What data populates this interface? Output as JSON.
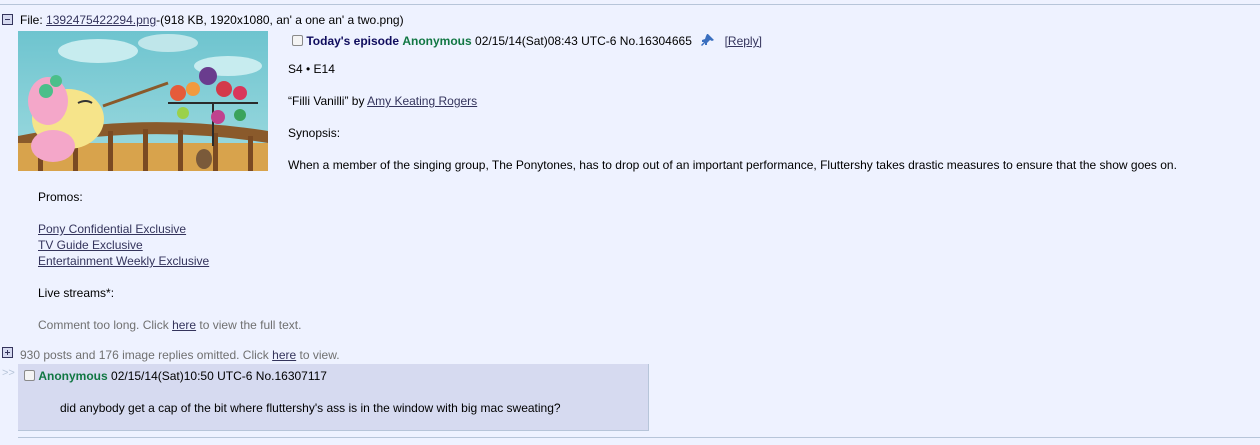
{
  "op": {
    "file": {
      "label": "File: ",
      "filename": "1392475422294.png",
      "meta": "-(918 KB, 1920x1080, an' a one an' a two.png)"
    },
    "subject": "Today's episode",
    "name": "Anonymous",
    "datetime": "02/15/14(Sat)08:43 UTC-6",
    "post_no": "No.16304665",
    "reply_link": "[Reply]",
    "episode": "S4 • E14",
    "title_quote": "“Filli Vanilli” by ",
    "writer": "Amy Keating Rogers",
    "synopsis_label": "Synopsis:",
    "synopsis": "When a member of the singing group, The Ponytones, has to drop out of an important performance, Fluttershy takes drastic measures to ensure that the show goes on.",
    "promos_label": "Promos:",
    "promos": [
      "Pony Confidential Exclusive",
      "TV Guide Exclusive",
      "Entertainment Weekly Exclusive"
    ],
    "live_streams": "Live streams*:",
    "comment_too_long": {
      "prefix": "Comment too long. Click ",
      "link": "here",
      "suffix": " to view the full text."
    }
  },
  "omitted": {
    "prefix": "930 posts and 176 image replies omitted. Click ",
    "link": "here",
    "suffix": " to view."
  },
  "reply": {
    "arrows": ">>",
    "name": "Anonymous",
    "datetime": "02/15/14(Sat)10:50 UTC-6",
    "post_no": "No.16307117",
    "message": "did anybody get a cap of the bit where fluttershy's ass is in the window with big mac sweating?"
  },
  "colors": {
    "background": "#eef2ff",
    "reply_background": "#d6daf0",
    "name": "#117743",
    "subject": "#0f0c5d",
    "link": "#34345c",
    "muted": "#707070"
  },
  "icons": [
    "minus-toggle-icon",
    "plus-toggle-icon",
    "sticky-pin-icon"
  ]
}
